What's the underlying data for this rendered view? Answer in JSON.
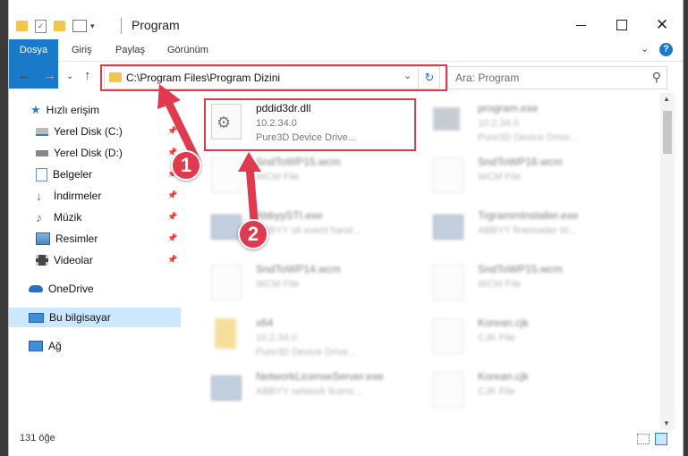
{
  "window": {
    "title": "Program"
  },
  "ribbon": {
    "tabs": [
      "Dosya",
      "Giriş",
      "Paylaş",
      "Görünüm"
    ]
  },
  "address": {
    "path": "C:\\Program Files\\Program Dizini"
  },
  "search": {
    "placeholder": "Ara: Program"
  },
  "sidebar": {
    "items": [
      {
        "label": "Hızlı erişim",
        "icon": "star-icon"
      },
      {
        "label": "Yerel Disk (C:)",
        "icon": "drive-icon"
      },
      {
        "label": "Yerel Disk (D:)",
        "icon": "drive-icon"
      },
      {
        "label": "Belgeler",
        "icon": "documents-icon"
      },
      {
        "label": "İndirmeler",
        "icon": "download-icon"
      },
      {
        "label": "Müzik",
        "icon": "music-icon"
      },
      {
        "label": "Resimler",
        "icon": "pictures-icon"
      },
      {
        "label": "Videolar",
        "icon": "video-icon"
      },
      {
        "label": "OneDrive",
        "icon": "cloud-icon"
      },
      {
        "label": "Bu bilgisayar",
        "icon": "computer-icon"
      },
      {
        "label": "Ağ",
        "icon": "network-icon"
      }
    ]
  },
  "files": [
    {
      "name": "pddid3dr.dll",
      "line1": "10.2.34.0",
      "line2": "Pure3D Device Drive..."
    },
    {
      "name": "program.exe",
      "line1": "10.2.34.0",
      "line2": "Pure3D Device Drive..."
    },
    {
      "name": "SndToWP15.wcm",
      "line1": "WCM File",
      "line2": ""
    },
    {
      "name": "SndToWP16.wcm",
      "line1": "WCM File",
      "line2": ""
    },
    {
      "name": "AbbyySTI.exe",
      "line1": "ABBYY sti event hand...",
      "line2": ""
    },
    {
      "name": "TrgrammInstaller.exe",
      "line1": "ABBYY finereader tri...",
      "line2": ""
    },
    {
      "name": "SndToWP14.wcm",
      "line1": "WCM File",
      "line2": ""
    },
    {
      "name": "SndToWP15.wcm",
      "line1": "WCM File",
      "line2": ""
    },
    {
      "name": "x64",
      "line1": "10.2.34.0",
      "line2": "Pure3D Device Drive..."
    },
    {
      "name": "Korean.cjk",
      "line1": "CJK File",
      "line2": ""
    },
    {
      "name": "NetworkLicenseServer.exe",
      "line1": "ABBYY network licens...",
      "line2": ""
    },
    {
      "name": "Korean.cjk",
      "line1": "CJK File",
      "line2": ""
    }
  ],
  "status": {
    "count": "131 öğe"
  },
  "annotations": {
    "step1": "1",
    "step2": "2"
  },
  "colors": {
    "accent": "#1979ca",
    "highlight": "#e03a4e",
    "selected": "#cce8ff"
  }
}
